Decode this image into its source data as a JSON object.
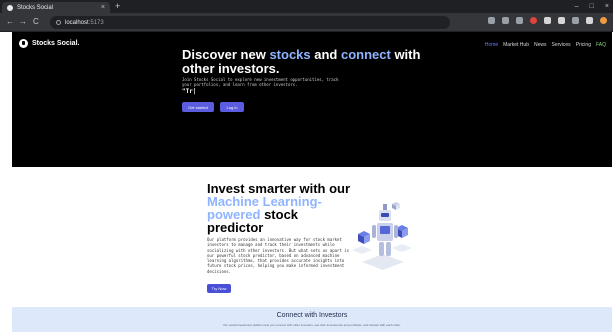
{
  "browser": {
    "tab_title": "Stocks Social",
    "new_tab_label": "+",
    "tab_close_label": "×",
    "url_host": "localhost",
    "url_port": ":5173",
    "nav_back": "←",
    "nav_forward": "→",
    "nav_reload": "C",
    "win_minimize": "–",
    "win_maximize": "□",
    "win_close": "×"
  },
  "site": {
    "logo_text": "Stocks Social.",
    "nav": [
      "Home",
      "Market Hub",
      "News",
      "Services",
      "Pricing",
      "FAQ"
    ]
  },
  "hero": {
    "title_part1": "Discover new ",
    "title_hl1": "stocks",
    "title_part2": " and ",
    "title_hl2": "connect",
    "title_part3": " with other investors.",
    "subtitle": "Join Stocks Social to explore new investment opportunities, track your portfolios, and learn from other investors.",
    "typed_text": "\"Tr|",
    "btn_start": "Get started",
    "btn_login": "Log in"
  },
  "predictor": {
    "title_part1": "Invest smarter with our ",
    "title_hl": "Machine Learning-powered",
    "title_part2": " stock predictor",
    "description": "Our platform provides an innovative way for stock market investors to manage and track their investments while socializing with other investors. But what sets us apart is our powerful stock predictor, based on advanced machine learning algorithms, that provides accurate insights into future stock prices, helping you make informed investment decisions.",
    "btn_try": "Try Now"
  },
  "connect": {
    "title": "Connect with Investors",
    "text": "Our social investment platform lets you connect with other investors, see their investments and portfolios, and interact with each other."
  },
  "colors": {
    "accent": "#5b5ce0",
    "highlight": "#8fb4ff",
    "hero_bg": "#000000",
    "connect_bg": "#dde8fb"
  }
}
